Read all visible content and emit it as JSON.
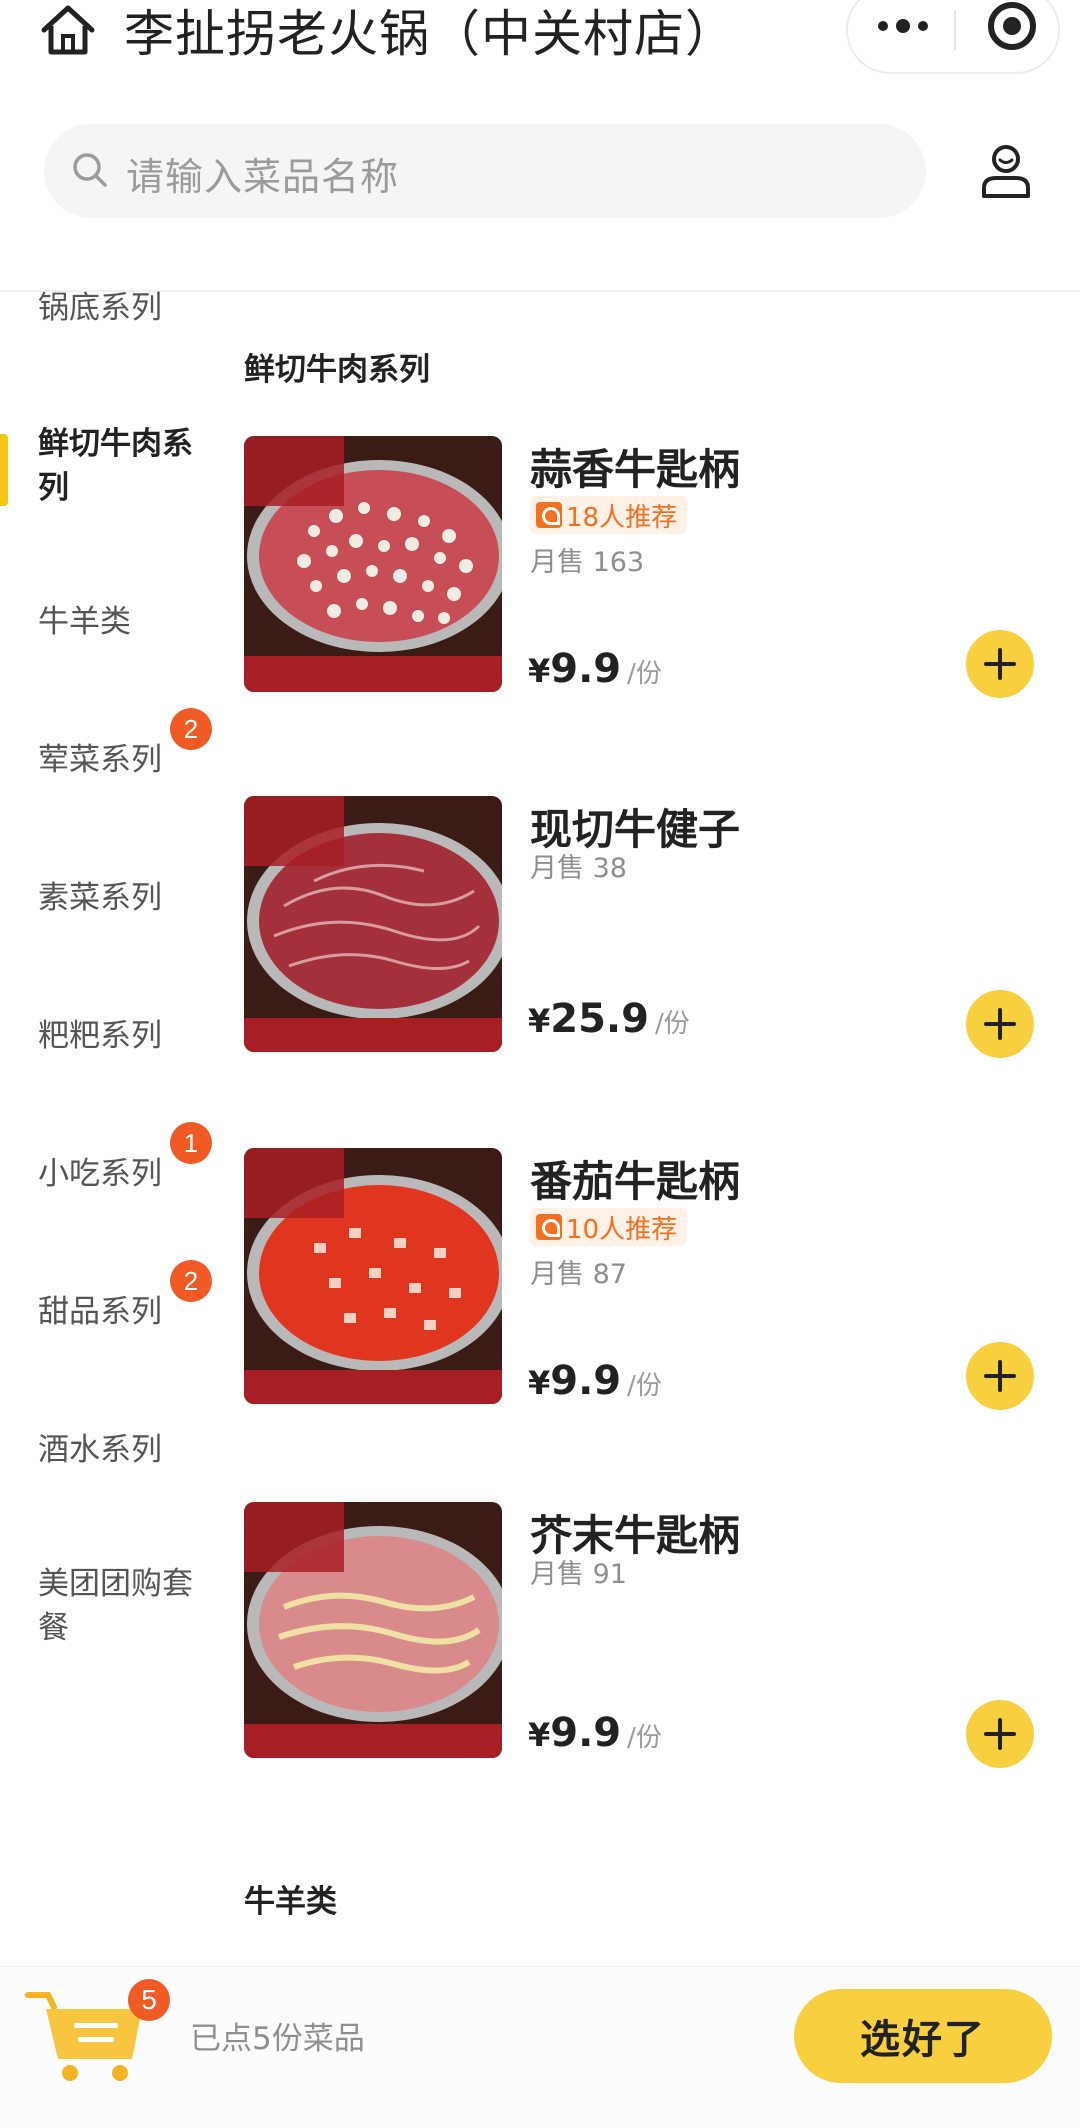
{
  "header": {
    "title": "李扯拐老火锅（中关村店）"
  },
  "search": {
    "placeholder": "请输入菜品名称"
  },
  "sidebar": {
    "items": [
      {
        "label": "锅底系列"
      },
      {
        "label": "鲜切牛肉系列",
        "active": true
      },
      {
        "label": "牛羊类"
      },
      {
        "label": "荤菜系列",
        "badge": "2"
      },
      {
        "label": "素菜系列"
      },
      {
        "label": "粑粑系列"
      },
      {
        "label": "小吃系列",
        "badge": "1"
      },
      {
        "label": "甜品系列",
        "badge": "2"
      },
      {
        "label": "酒水系列"
      },
      {
        "label": "美团团购套餐"
      }
    ]
  },
  "sections": [
    {
      "title": "鲜切牛肉系列",
      "dishes": [
        {
          "name": "蒜香牛匙柄",
          "recommend": "18人推荐",
          "sales": "月售 163",
          "currency": "¥",
          "price": "9.9",
          "unit": "/份",
          "image_icon": "garlic-beef-dish"
        },
        {
          "name": "现切牛健子",
          "sales": "月售 38",
          "currency": "¥",
          "price": "25.9",
          "unit": "/份",
          "image_icon": "sliced-beef-dish"
        },
        {
          "name": "番茄牛匙柄",
          "recommend": "10人推荐",
          "sales": "月售 87",
          "currency": "¥",
          "price": "9.9",
          "unit": "/份",
          "image_icon": "tomato-beef-dish"
        },
        {
          "name": "芥末牛匙柄",
          "sales": "月售 91",
          "currency": "¥",
          "price": "9.9",
          "unit": "/份",
          "image_icon": "wasabi-beef-dish"
        }
      ]
    },
    {
      "title": "牛羊类"
    }
  ],
  "cart": {
    "count": "5",
    "summary": "已点5份菜品",
    "checkout_label": "选好了"
  },
  "colors": {
    "accent": "#f7cf3f",
    "badge": "#f05a24",
    "recommend": "#f37021"
  }
}
